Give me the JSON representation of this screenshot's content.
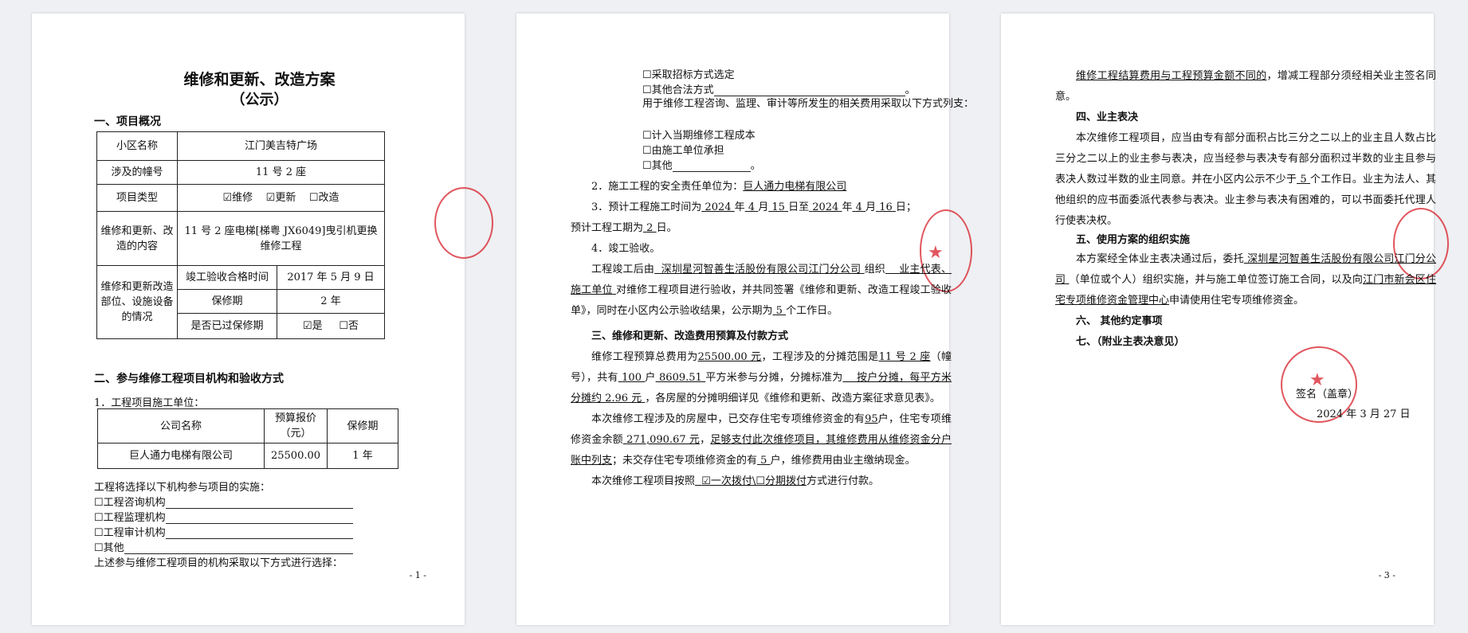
{
  "page1": {
    "title": "维修和更新、改造方案",
    "subtitle": "（公示）",
    "section1": "一、项目概况",
    "table": {
      "community_label": "小区名称",
      "community_value": "江门美吉特广场",
      "building_label": "涉及的幢号",
      "building_value": "11 号 2 座",
      "type_label": "项目类型",
      "type_opt1": "☑维修",
      "type_opt2": "☑更新",
      "type_opt3": "☐改造",
      "content_label": "维修和更新、改造的内容",
      "content_value": "11 号 2 座电梯[梯粤 JX6049]曳引机更换维修工程",
      "parts_label": "维修和更新改造部位、设施设备的情况",
      "accept_label": "竣工验收合格时间",
      "accept_value": "2017 年 5 月 9 日",
      "warranty_label": "保修期",
      "warranty_value": "2 年",
      "expired_label": "是否已过保修期",
      "expired_yes": "☑是",
      "expired_no": "☐否"
    },
    "section2": "二、参与维修工程项目机构和验收方式",
    "unit_heading": "1．工程项目施工单位：",
    "unit_table": {
      "h_company": "公司名称",
      "h_budget": "预算报价（元）",
      "h_warranty": "保修期",
      "company": "巨人通力电梯有限公司",
      "budget": "25500.00",
      "warranty": "1 年"
    },
    "select_intro": "工程将选择以下机构参与项目的实施：",
    "orgs": [
      "☐工程咨询机构",
      "☐工程监理机构",
      "☐工程审计机构",
      "☐其他"
    ],
    "select_method": "上述参与维修工程项目的机构采取以下方式进行选择：",
    "page_number": "- 1 -"
  },
  "page2": {
    "opt_bid": "☐采取招标方式选定",
    "opt_other": "☐其他合法方式",
    "cost_intro": "用于维修工程咨询、监理、审计等所发生的相关费用采取以下方式列支：",
    "cost_opts": [
      "☐计入当期维修工程成本",
      "☐由施工单位承担",
      "☐其他"
    ],
    "safety_prefix": "2．施工工程的安全责任单位为：",
    "safety_unit": "巨人通力电梯有限公司",
    "time_prefix": "3．预计工程施工时间为",
    "time_y1": "2024",
    "time_m1": "4",
    "time_d1": "15",
    "time_y2": "2024",
    "time_m2": "4",
    "time_d2": "16",
    "period_prefix": "预计工程工期为",
    "period_days": "2",
    "accept_heading": "4．竣工验收。",
    "accept_org": "深圳星河智善生活股份有限公司江门分公司",
    "accept_parties": "业主代表、施工单位",
    "accept_text": "对维修工程项目进行验收，并共同签署《维修和更新、改造工程竣工验收单》，同时在小区内公示验收结果，公示期为",
    "accept_days": "5",
    "section3": "三、维修和更新、改造费用预算及付款方式",
    "budget_total": "25500.00 元",
    "share_scope": "11 号 2 座",
    "households": "100",
    "area": "8609.51",
    "share_std": "按户分摊，每平方米分摊约 2.96 元",
    "paid_households": "95",
    "balance": "271,090.67 元",
    "sufficient": "足够支付此次维修项目，其维修费用从维修资金分户账中列支",
    "unpaid_households": "5",
    "pay_method": "☑一次拨付\\☐分期拨付",
    "page_number": ""
  },
  "page3": {
    "diff_text": "维修工程结算费用与工程预算金额不同的",
    "diff_tail": "，增减工程部分须经相关业主签名同意。",
    "section4": "四、业主表决",
    "vote_days": "5",
    "section5": "五、使用方案的组织实施",
    "impl_org": "深圳星河智善生活股份有限公司江门分公司",
    "impl_center": "江门市新会区住宅专项维修资金管理中心",
    "section6": "六、 其他约定事项",
    "section7": "七、（附业主表决意见）",
    "sign": "签名（盖章）",
    "date": "2024 年 3 月 27 日",
    "page_number": "- 3 -"
  },
  "colors": {
    "seal": "#d71e28",
    "page_bg": "#ffffff",
    "viewer_bg": "#eef0f3"
  }
}
